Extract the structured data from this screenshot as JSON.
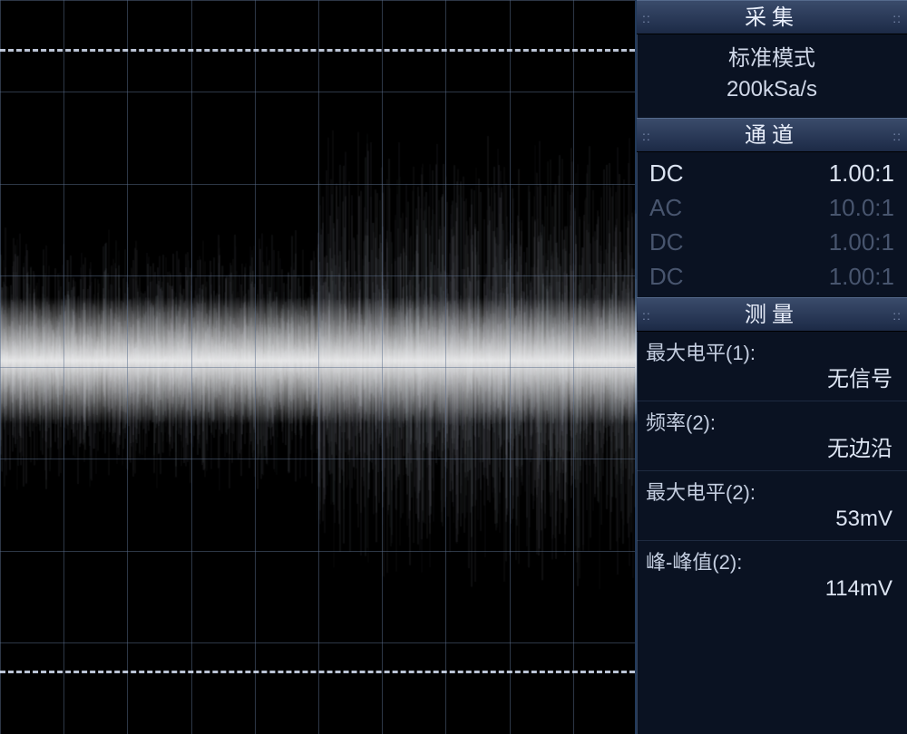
{
  "acquisition": {
    "title": "采集",
    "mode": "标准模式",
    "rate": "200kSa/s"
  },
  "channel": {
    "title": "通道",
    "rows": [
      {
        "name": "DC",
        "ratio": "1.00:1",
        "active": true
      },
      {
        "name": "AC",
        "ratio": "10.0:1",
        "active": false
      },
      {
        "name": "DC",
        "ratio": "1.00:1",
        "active": false
      },
      {
        "name": "DC",
        "ratio": "1.00:1",
        "active": false
      }
    ]
  },
  "measure": {
    "title": "测量",
    "items": [
      {
        "label": "最大电平(1):",
        "value": "无信号"
      },
      {
        "label": "频率(2):",
        "value": "无边沿"
      },
      {
        "label": "最大电平(2):",
        "value": "53mV"
      },
      {
        "label": "峰-峰值(2):",
        "value": "114mV"
      }
    ]
  }
}
